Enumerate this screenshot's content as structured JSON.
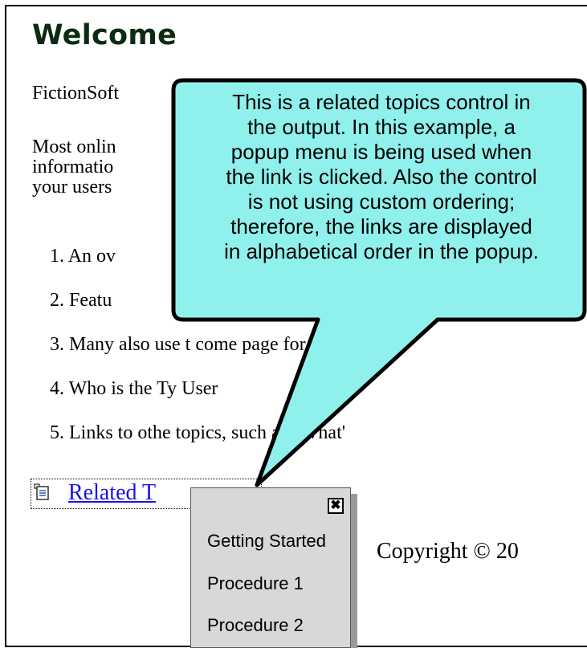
{
  "heading": "Welcome",
  "intro_text": "FictionSoft",
  "paragraph": [
    "Most onlin",
    "informatio",
    "your users"
  ],
  "list_items": [
    {
      "number": "1.",
      "text": "An ov"
    },
    {
      "number": "2.",
      "text": "Featu"
    },
    {
      "number": "3.",
      "text": "Many also use t     come page for"
    },
    {
      "number": "4.",
      "text": "Who is the Ty      User"
    },
    {
      "number": "5.",
      "text": "Links to othe   topics, such as \"What'"
    }
  ],
  "related_topics": {
    "link_text": "Related T",
    "icon": "document-list-icon"
  },
  "popup": {
    "close_label": "✖",
    "items": [
      "Getting Started",
      "Procedure 1",
      "Procedure 2"
    ]
  },
  "copyright": "Copyright © 20",
  "callout": {
    "lines": [
      "This is a related topics control in",
      "the output. In this example, a",
      "popup menu is being used when",
      "the link is clicked. Also the control",
      "is not using custom ordering;",
      "therefore, the links are displayed",
      "in alphabetical order in the popup."
    ],
    "fill_color": "#8ff0ec"
  }
}
